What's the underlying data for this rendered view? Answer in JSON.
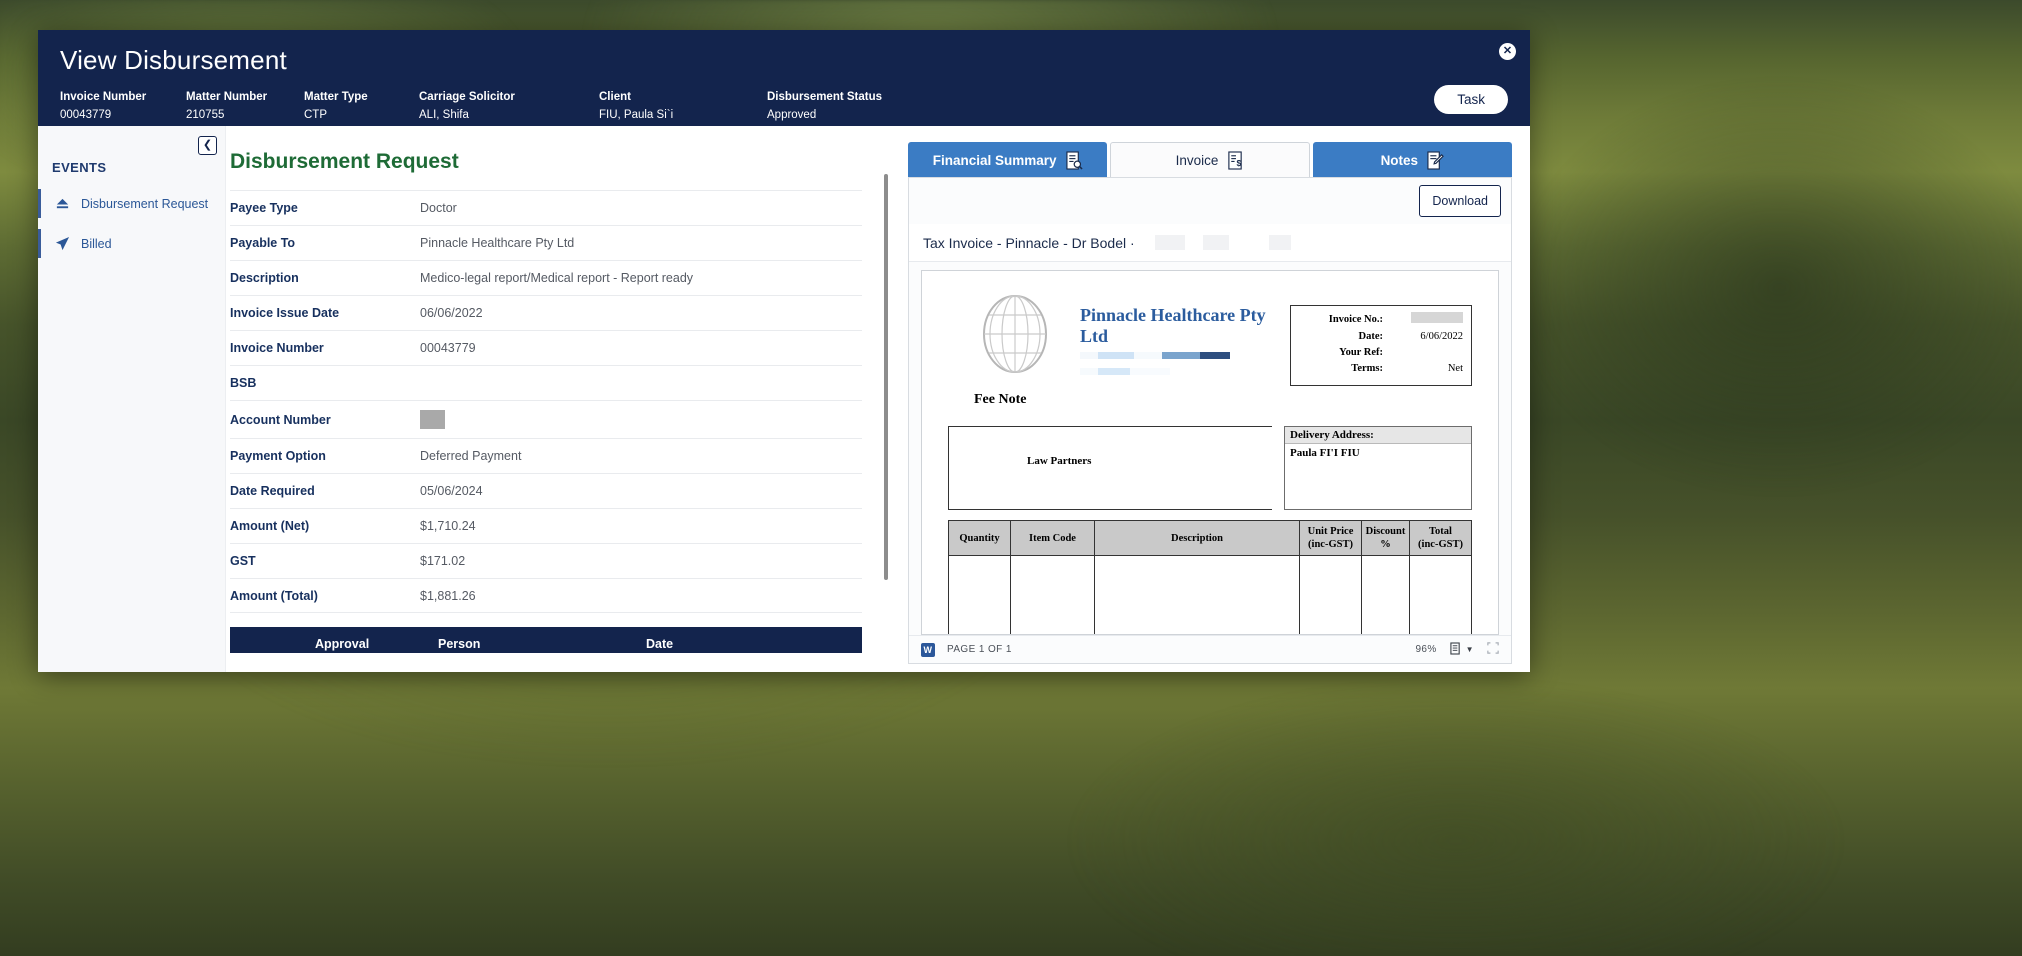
{
  "window": {
    "title": "View Disbursement",
    "close_icon": "close-circle-icon",
    "task_button": "Task"
  },
  "header_fields": [
    {
      "label": "Invoice Number",
      "value": "00043779"
    },
    {
      "label": "Matter Number",
      "value": "210755"
    },
    {
      "label": "Matter Type",
      "value": "CTP"
    },
    {
      "label": "Carriage Solicitor",
      "value": "ALI, Shifa"
    },
    {
      "label": "Client",
      "value": "FIU, Paula Si`i"
    },
    {
      "label": "Disbursement Status",
      "value": "Approved"
    }
  ],
  "events": {
    "title": "EVENTS",
    "collapse_icon": "chevron-left-icon",
    "items": [
      {
        "label": "Disbursement Request",
        "icon": "eject-icon"
      },
      {
        "label": "Billed",
        "icon": "send-icon"
      }
    ]
  },
  "form": {
    "title": "Disbursement Request",
    "rows": [
      {
        "label": "Payee Type",
        "value": "Doctor"
      },
      {
        "label": "Payable To",
        "value": "Pinnacle Healthcare Pty Ltd"
      },
      {
        "label": "Description",
        "value": "Medico-legal report/Medical report - Report ready"
      },
      {
        "label": "Invoice Issue Date",
        "value": "06/06/2022"
      },
      {
        "label": "Invoice Number",
        "value": "00043779"
      },
      {
        "label": "BSB",
        "value": ""
      },
      {
        "label": "Account Number",
        "value": "",
        "redacted": true
      },
      {
        "label": "Payment Option",
        "value": "Deferred Payment"
      },
      {
        "label": "Date Required",
        "value": "05/06/2024"
      },
      {
        "label": "Amount (Net)",
        "value": "$1,710.24"
      },
      {
        "label": "GST",
        "value": "$171.02"
      },
      {
        "label": "Amount (Total)",
        "value": "$1,881.26"
      }
    ],
    "approval_table_headers": [
      "Approval",
      "Person",
      "Date"
    ]
  },
  "doc_panel": {
    "tabs": [
      {
        "label": "Financial Summary",
        "icon": "document-search-icon",
        "active": false
      },
      {
        "label": "Invoice",
        "icon": "document-dollar-icon",
        "active": true
      },
      {
        "label": "Notes",
        "icon": "document-pen-icon",
        "active": false
      }
    ],
    "download_button": "Download",
    "document_name": "Tax Invoice - Pinnacle - Dr Bodel ·",
    "footer": {
      "page_status": "PAGE 1 OF 1",
      "zoom": "96%",
      "view_icon": "page-view-icon",
      "dropdown_icon": "chevron-down-icon",
      "fit_icon": "fit-page-icon",
      "app_icon": "word-icon"
    }
  },
  "invoice": {
    "logo_icon": "globe-icon",
    "company_name": "Pinnacle Healthcare Pty Ltd",
    "fee_note": "Fee Note",
    "details": [
      {
        "label": "Invoice No.:",
        "value": "",
        "redacted": true
      },
      {
        "label": "Date:",
        "value": "6/06/2022"
      },
      {
        "label": "Your Ref:",
        "value": ""
      },
      {
        "label": "Terms:",
        "value": "Net"
      }
    ],
    "bill_to": "Law Partners",
    "delivery_label": "Delivery Address:",
    "delivery_value": "Paula FI'I FIU",
    "table_headers": [
      "Quantity",
      "Item Code",
      "Description",
      "Unit Price\n(inc-GST)",
      "Discount\n%",
      "Total\n(inc-GST)"
    ],
    "table_headers_flat": {
      "quantity": "Quantity",
      "item_code": "Item Code",
      "description": "Description",
      "unit_price_l1": "Unit Price",
      "unit_price_l2": "(inc-GST)",
      "discount_l1": "Discount",
      "discount_l2": "%",
      "total_l1": "Total",
      "total_l2": "(inc-GST)"
    }
  },
  "colors": {
    "header_navy": "#13244d",
    "tab_blue": "#3b7cc4",
    "title_green": "#1e6b36",
    "label_navy": "#17305e"
  }
}
